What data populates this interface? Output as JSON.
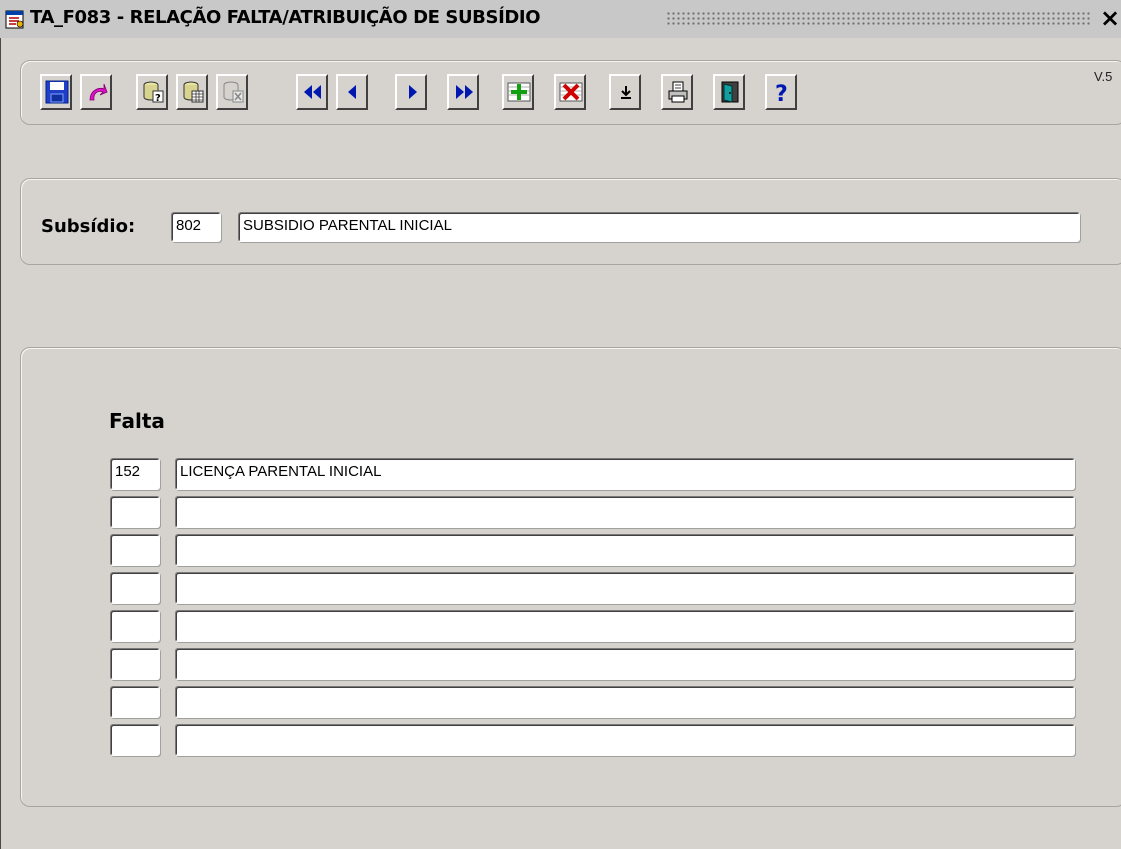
{
  "window": {
    "title": "TA_F083 - RELAÇÃO FALTA/ATRIBUIÇÃO DE SUBSÍDIO",
    "close_label": "×",
    "version": "V.5"
  },
  "toolbar": {
    "buttons": [
      {
        "name": "save-button",
        "icon": "floppy-disk-icon"
      },
      {
        "name": "undo-button",
        "icon": "undo-arrow-icon"
      },
      {
        "name": "query-button",
        "icon": "database-query-icon"
      },
      {
        "name": "execute-query-button",
        "icon": "database-execute-icon"
      },
      {
        "name": "cancel-query-button",
        "icon": "database-cancel-icon"
      },
      {
        "name": "first-record-button",
        "icon": "double-left-arrow-icon"
      },
      {
        "name": "previous-record-button",
        "icon": "left-arrow-icon"
      },
      {
        "name": "next-record-button",
        "icon": "right-arrow-icon"
      },
      {
        "name": "last-record-button",
        "icon": "double-right-arrow-icon"
      },
      {
        "name": "insert-record-button",
        "icon": "plus-icon"
      },
      {
        "name": "delete-record-button",
        "icon": "x-icon"
      },
      {
        "name": "list-values-button",
        "icon": "download-arrow-icon"
      },
      {
        "name": "print-button",
        "icon": "printer-icon"
      },
      {
        "name": "exit-button",
        "icon": "door-exit-icon"
      },
      {
        "name": "help-button",
        "icon": "question-mark-icon"
      }
    ]
  },
  "subsidio": {
    "label": "Subsídio:",
    "code": "802",
    "description": "SUBSIDIO PARENTAL INICIAL"
  },
  "falta": {
    "header": "Falta",
    "rows": [
      {
        "code": "152",
        "description": "LICENÇA PARENTAL INICIAL"
      },
      {
        "code": "",
        "description": ""
      },
      {
        "code": "",
        "description": ""
      },
      {
        "code": "",
        "description": ""
      },
      {
        "code": "",
        "description": ""
      },
      {
        "code": "",
        "description": ""
      },
      {
        "code": "",
        "description": ""
      },
      {
        "code": "",
        "description": ""
      }
    ]
  }
}
